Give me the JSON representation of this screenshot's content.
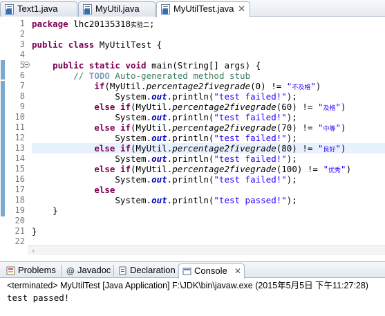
{
  "editor_tabs": [
    {
      "label": "Text1.java",
      "active": false
    },
    {
      "label": "MyUtil.java",
      "active": false
    },
    {
      "label": "MyUtilTest.java",
      "active": true,
      "close": "✕"
    }
  ],
  "line_numbers": [
    "1",
    "2",
    "3",
    "4",
    "5",
    "6",
    "7",
    "8",
    "9",
    "10",
    "11",
    "12",
    "13",
    "14",
    "15",
    "16",
    "17",
    "18",
    "19",
    "20",
    "21",
    "22"
  ],
  "code": {
    "l1": [
      "package",
      " lhc20135318",
      "实验二",
      ";"
    ],
    "l3": [
      "public",
      " ",
      "class",
      " MyUtilTest {"
    ],
    "l5": [
      "    ",
      "public",
      " ",
      "static",
      " ",
      "void",
      " main(String[] args) {"
    ],
    "l6": [
      "        // ",
      "TODO",
      " Auto-generated method stub"
    ],
    "l7": [
      "            ",
      "if",
      "(MyUtil.",
      "percentage2fivegrade",
      "(0) != ",
      "\"",
      "不及格",
      "\"",
      ")"
    ],
    "l8": [
      "                System.",
      "out",
      ".println(",
      "\"test failed!\"",
      ");"
    ],
    "l9": [
      "            ",
      "else",
      " ",
      "if",
      "(MyUtil.",
      "percentage2fivegrade",
      "(60) != ",
      "\"",
      "及格",
      "\"",
      ")"
    ],
    "l10": [
      "                System.",
      "out",
      ".println(",
      "\"test failed!\"",
      ");"
    ],
    "l11": [
      "            ",
      "else",
      " ",
      "if",
      "(MyUtil.",
      "percentage2fivegrade",
      "(70) != ",
      "\"",
      "中等",
      "\"",
      ")"
    ],
    "l12": [
      "                System.",
      "out",
      ".println(",
      "\"test failed!\"",
      ");"
    ],
    "l13": [
      "            ",
      "else",
      " ",
      "if",
      "(MyUtil.",
      "percentage2fivegrade",
      "(80) != ",
      "\"",
      "良好",
      "\"",
      ")"
    ],
    "l14": [
      "                System.",
      "out",
      ".println(",
      "\"test failed!\"",
      ");"
    ],
    "l15": [
      "            ",
      "else",
      " ",
      "if",
      "(MyUtil.",
      "percentage2fivegrade",
      "(100) != ",
      "\"",
      "优秀",
      "\"",
      ")"
    ],
    "l16": [
      "                System.",
      "out",
      ".println(",
      "\"test failed!\"",
      ");"
    ],
    "l17": [
      "            ",
      "else"
    ],
    "l18": [
      "                System.",
      "out",
      ".println(",
      "\"test passed!\"",
      ");"
    ],
    "l19": [
      "    }"
    ],
    "l21": [
      "}"
    ]
  },
  "view_tabs": [
    {
      "label": "Problems",
      "icon": "problems-icon"
    },
    {
      "label": "Javadoc",
      "icon": "at-icon"
    },
    {
      "label": "Declaration",
      "icon": "declaration-icon"
    },
    {
      "label": "Console",
      "icon": "console-icon",
      "active": true,
      "close": "✕"
    }
  ],
  "console": {
    "status": "<terminated> MyUtilTest [Java Application] F:\\JDK\\bin\\javaw.exe (2015年5月5日 下午11:27:28)",
    "output": "test passed!"
  },
  "colors": {
    "keyword": "#7f0055",
    "string": "#2a00ff",
    "field": "#0000c0",
    "comment": "#3f7f5f",
    "current_line": "#e8f2fe"
  }
}
